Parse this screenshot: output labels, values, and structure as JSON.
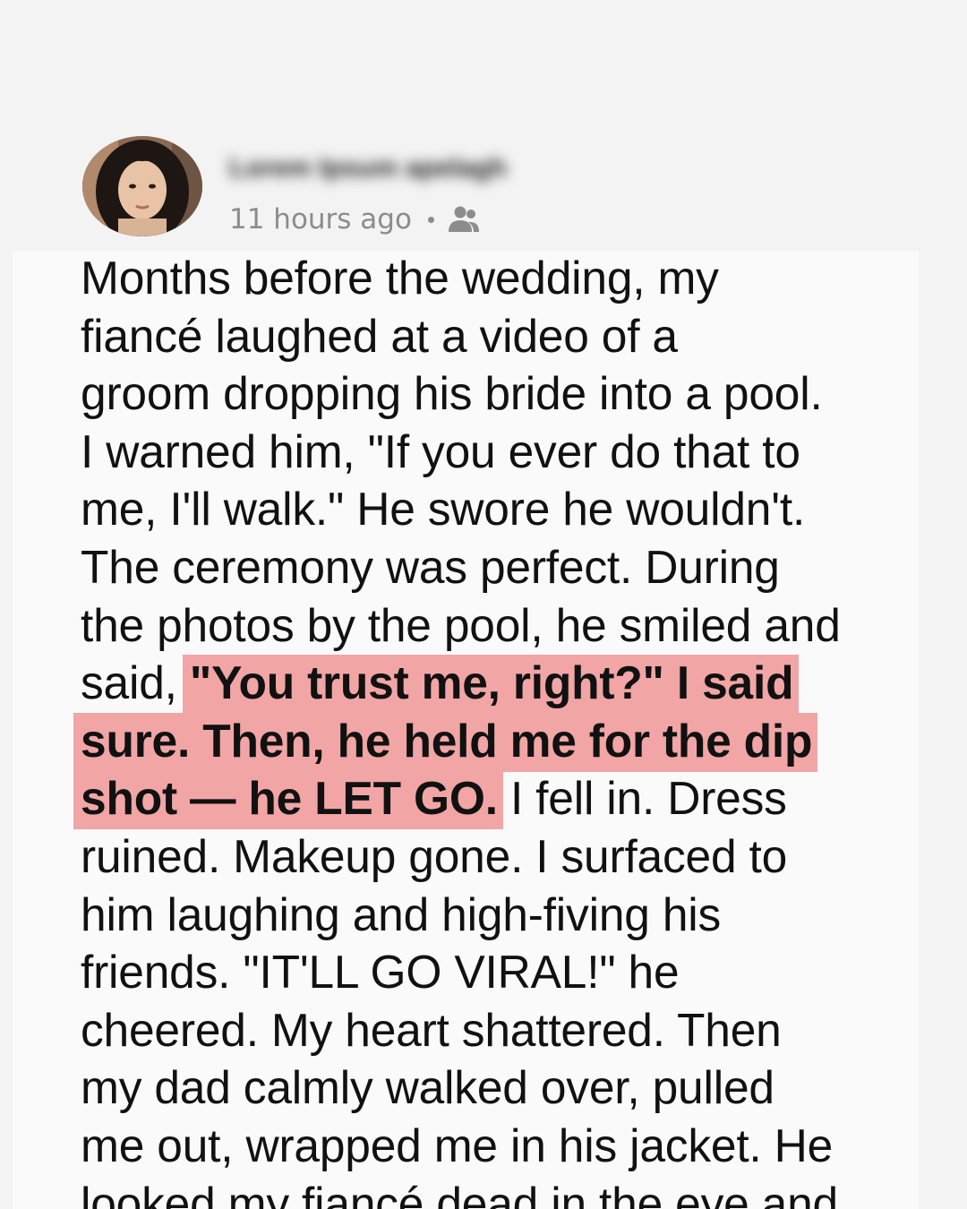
{
  "post": {
    "author_name": "Lorem Ipsum apelagh",
    "timestamp": "11 hours ago",
    "audience_icon": "friends-icon",
    "highlight_color": "#f2a5a5",
    "lines": [
      [
        {
          "t": "Months before the wedding, my"
        }
      ],
      [
        {
          "t": "fiancé laughed at a video of a"
        }
      ],
      [
        {
          "t": "groom dropping his bride into a pool."
        }
      ],
      [
        {
          "t": "I warned him, \"If you ever do that to"
        }
      ],
      [
        {
          "t": "me, I'll walk.\" He swore he wouldn't."
        }
      ],
      [
        {
          "t": "The ceremony was perfect. During"
        }
      ],
      [
        {
          "t": "the photos by the pool, he smiled and"
        }
      ],
      [
        {
          "t": "said, "
        },
        {
          "t": "\"You trust me, right?\" I said",
          "hl": true
        }
      ],
      [
        {
          "t": "sure. Then, he held me for the dip",
          "hl": true
        }
      ],
      [
        {
          "t": "shot  — he LET GO.",
          "hl": true
        },
        {
          "t": " I fell in. Dress"
        }
      ],
      [
        {
          "t": "ruined. Makeup gone. I surfaced to"
        }
      ],
      [
        {
          "t": "him laughing and high-fiving his"
        }
      ],
      [
        {
          "t": "friends. \"IT'LL GO VIRAL!\" he"
        }
      ],
      [
        {
          "t": "cheered. My heart shattered. Then"
        }
      ],
      [
        {
          "t": "my dad calmly walked over, pulled"
        }
      ],
      [
        {
          "t": "me out, wrapped me in his jacket. He"
        }
      ],
      [
        {
          "t": "looked my fiancé dead in the eye and"
        }
      ]
    ]
  }
}
